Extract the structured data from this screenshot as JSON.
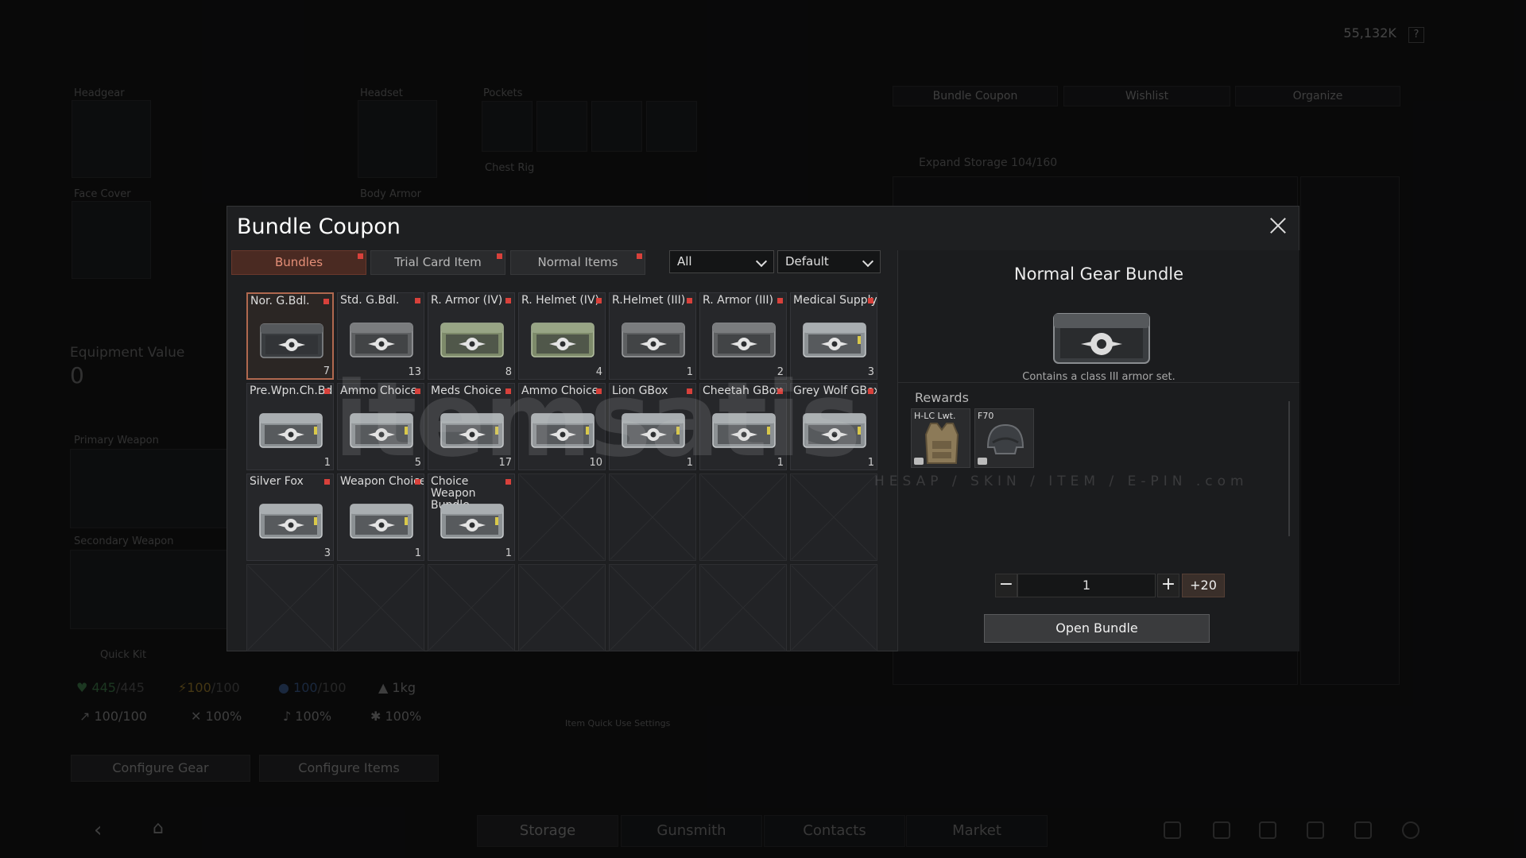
{
  "header": {
    "currency_value": "55,132K",
    "help_label": "?"
  },
  "equipment": {
    "labels": {
      "headgear": "Headgear",
      "headset": "Headset",
      "pockets": "Pockets",
      "face_cover": "Face Cover",
      "body_armor": "Body Armor",
      "chest_rig": "Chest Rig",
      "equipment_value": "Equipment Value",
      "primary_weapon": "Primary Weapon",
      "secondary_weapon": "Secondary Weapon",
      "quick_kit": "Quick Kit"
    },
    "equipment_value": "0",
    "stats": {
      "health": "445",
      "health_max": "/445",
      "energy": "100",
      "energy_max": "/100",
      "water": "100",
      "water_max": "/100",
      "weight": "1kg",
      "stat_a": "100/100",
      "stat_b": "100%",
      "stat_c": "100%",
      "stat_d": "100%"
    },
    "configure_gear": "Configure Gear",
    "configure_items": "Configure Items",
    "item_quick_use": "Item Quick Use Settings"
  },
  "storage_panel": {
    "tabs": [
      "Bundle Coupon",
      "Wishlist",
      "Organize"
    ],
    "expand_storage": "Expand Storage 104/160"
  },
  "bottom_nav": {
    "tabs": [
      "Storage",
      "Gunsmith",
      "Contacts",
      "Market"
    ],
    "active": "Storage"
  },
  "modal": {
    "title": "Bundle Coupon",
    "tabs": [
      {
        "label": "Bundles",
        "active": true
      },
      {
        "label": "Trial Card Item",
        "active": false
      },
      {
        "label": "Normal Items",
        "active": false
      }
    ],
    "filter_value": "All",
    "sort_value": "Default",
    "items": [
      {
        "name": "Nor. G.Bdl.",
        "count": "7",
        "style": "dark",
        "selected": true
      },
      {
        "name": "Std. G.Bdl.",
        "count": "13",
        "style": "camo"
      },
      {
        "name": "R. Armor (IV)",
        "count": "8",
        "style": "green"
      },
      {
        "name": "R. Helmet (IV)",
        "count": "4",
        "style": "green"
      },
      {
        "name": "R.Helmet (III)",
        "count": "1",
        "style": "camo"
      },
      {
        "name": "R. Armor (III)",
        "count": "2",
        "style": "camo"
      },
      {
        "name": "Medical Supply",
        "count": "3",
        "style": "silver"
      },
      {
        "name": "Pre.Wpn.Ch.Bdl.",
        "count": "1",
        "style": "silver"
      },
      {
        "name": "Ammo Choice",
        "count": "5",
        "style": "silver"
      },
      {
        "name": "Meds Choice",
        "count": "17",
        "style": "silver"
      },
      {
        "name": "Ammo Choice",
        "count": "10",
        "style": "silver"
      },
      {
        "name": "Lion GBox",
        "count": "1",
        "style": "silver"
      },
      {
        "name": "Cheetah GBox",
        "count": "1",
        "style": "silver"
      },
      {
        "name": "Grey Wolf GBox",
        "count": "1",
        "style": "silver"
      },
      {
        "name": "Silver Fox",
        "count": "3",
        "style": "silver"
      },
      {
        "name": "Weapon Choice",
        "count": "1",
        "style": "silver"
      },
      {
        "name": "Choice Weapon Bundle",
        "count": "1",
        "style": "silver"
      }
    ],
    "detail": {
      "title": "Normal Gear Bundle",
      "description": "Contains a class III armor set.",
      "rewards_label": "Rewards",
      "rewards": [
        {
          "name": "H-LC Lwt."
        },
        {
          "name": "F70"
        }
      ],
      "quantity": "1",
      "minus_label": "−",
      "plus_label": "+",
      "plus20_label": "+20",
      "open_label": "Open Bundle"
    }
  },
  "watermark": {
    "main": "itemsatis",
    "sub": "HESAP / SKIN / ITEM / E-PIN .com"
  },
  "colors": {
    "accent": "#e58f78",
    "accent_bg": "#4a2a22",
    "new_dot": "#d8413b"
  }
}
